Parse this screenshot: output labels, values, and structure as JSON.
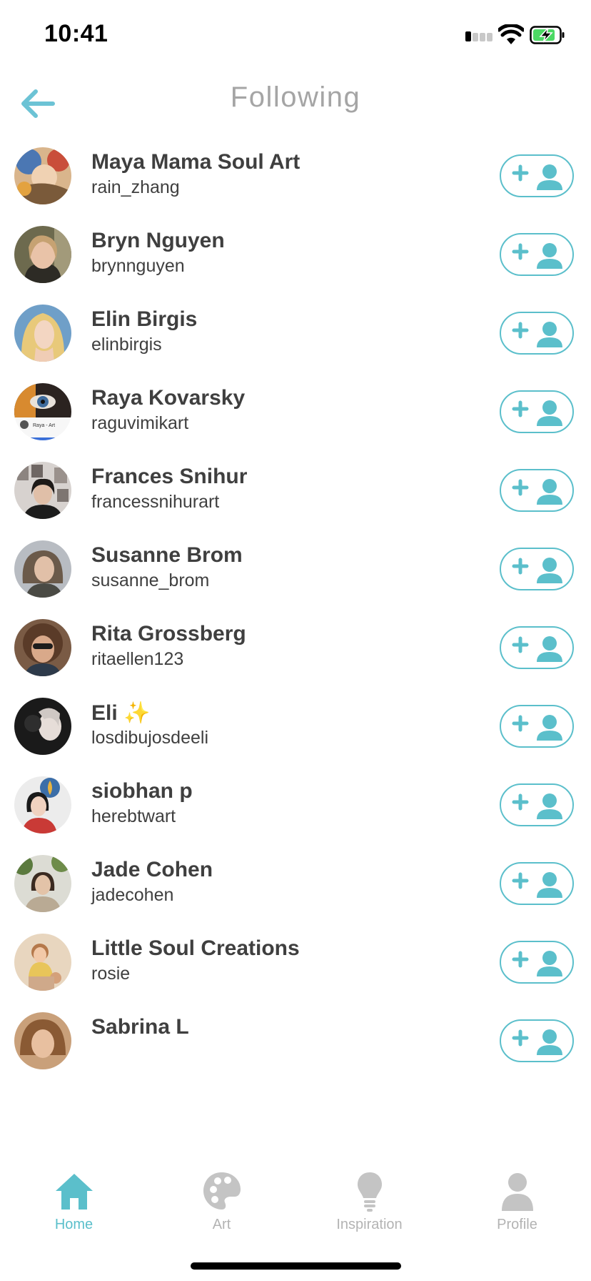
{
  "status_bar": {
    "time": "10:41"
  },
  "header": {
    "title": "Following"
  },
  "accent_color": "#5bbfcb",
  "following": [
    {
      "name": "Maya Mama Soul Art",
      "handle": "rain_zhang"
    },
    {
      "name": "Bryn Nguyen",
      "handle": "brynnguyen"
    },
    {
      "name": "Elin Birgis",
      "handle": "elinbirgis"
    },
    {
      "name": "Raya Kovarsky",
      "handle": "raguvimikart",
      "avatar_text": "Raya - Art"
    },
    {
      "name": "Frances Snihur",
      "handle": "francessnihurart"
    },
    {
      "name": "Susanne Brom",
      "handle": "susanne_brom"
    },
    {
      "name": "Rita Grossberg",
      "handle": "ritaellen123"
    },
    {
      "name": "Eli ✨",
      "handle": "losdibujosdeeli"
    },
    {
      "name": "siobhan p",
      "handle": "herebtwart"
    },
    {
      "name": "Jade Cohen",
      "handle": "jadecohen"
    },
    {
      "name": "Little Soul Creations",
      "handle": "rosie"
    },
    {
      "name": "Sabrina L",
      "handle": ""
    }
  ],
  "tab_bar": {
    "tabs": [
      {
        "label": "Home",
        "icon": "home-icon",
        "active": true
      },
      {
        "label": "Art",
        "icon": "palette-icon",
        "active": false
      },
      {
        "label": "Inspiration",
        "icon": "lightbulb-icon",
        "active": false
      },
      {
        "label": "Profile",
        "icon": "profile-icon",
        "active": false
      }
    ]
  }
}
